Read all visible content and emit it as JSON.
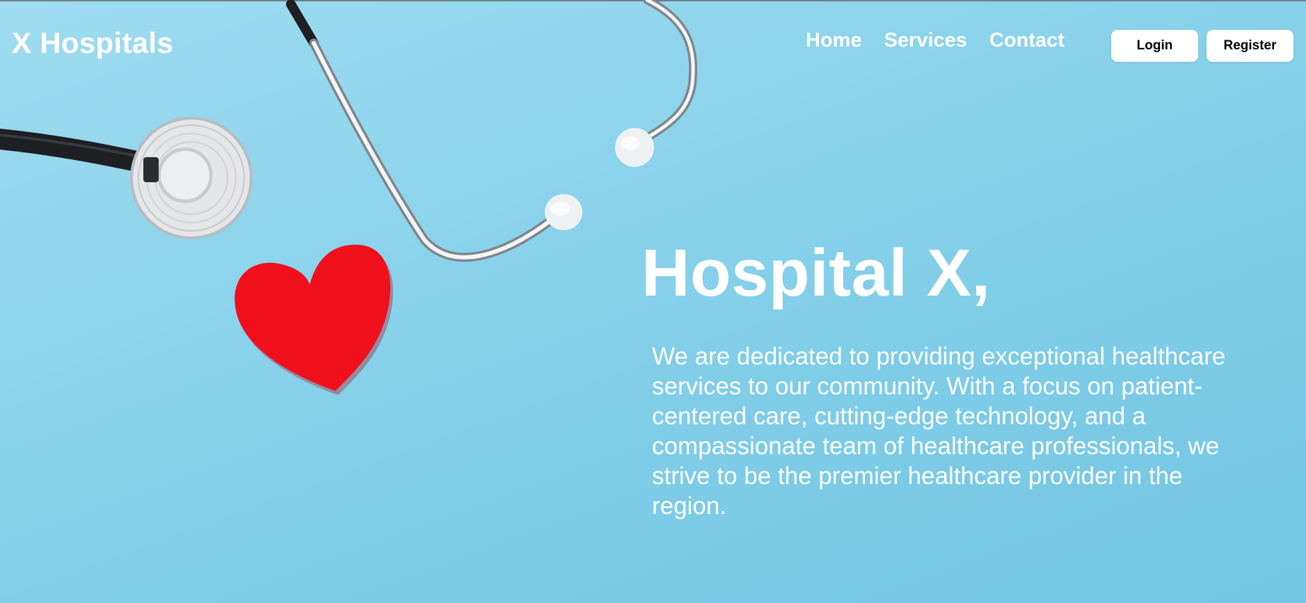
{
  "brand": {
    "name": "X Hospitals"
  },
  "nav": {
    "items": [
      {
        "label": "Home"
      },
      {
        "label": "Services"
      },
      {
        "label": "Contact"
      }
    ]
  },
  "auth": {
    "login_label": "Login",
    "register_label": "Register"
  },
  "hero": {
    "title": "Hospital X,",
    "description": "We are dedicated to providing exceptional healthcare services to our community. With a focus on patient-centered care, cutting-edge technology, and a compassionate team of healthcare professionals, we strive to be the premier healthcare provider in the region."
  },
  "background": {
    "image_subject": "stethoscope and red paper heart on light blue background",
    "icons": [
      "stethoscope-icon",
      "heart-icon"
    ]
  },
  "colors": {
    "background": "#8cd3ec",
    "text": "#ffffff",
    "button_bg": "#ffffff",
    "button_text": "#000000",
    "heart": "#f0101c"
  }
}
